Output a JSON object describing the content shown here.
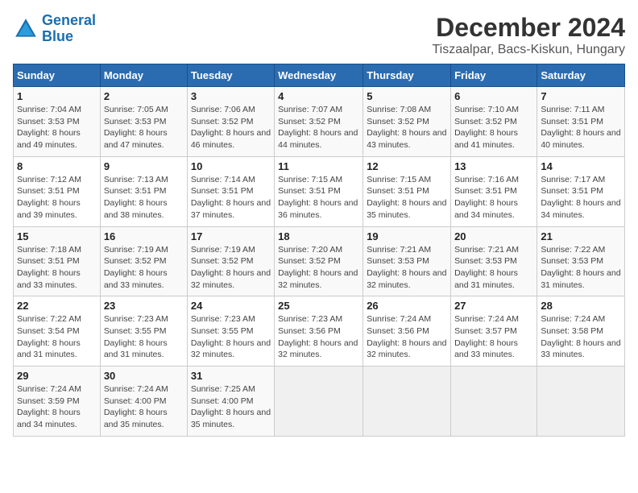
{
  "header": {
    "logo_line1": "General",
    "logo_line2": "Blue",
    "month_title": "December 2024",
    "location": "Tiszaalpar, Bacs-Kiskun, Hungary"
  },
  "calendar": {
    "weekdays": [
      "Sunday",
      "Monday",
      "Tuesday",
      "Wednesday",
      "Thursday",
      "Friday",
      "Saturday"
    ],
    "weeks": [
      [
        {
          "day": "1",
          "sunrise": "7:04 AM",
          "sunset": "3:53 PM",
          "daylight": "8 hours and 49 minutes."
        },
        {
          "day": "2",
          "sunrise": "7:05 AM",
          "sunset": "3:53 PM",
          "daylight": "8 hours and 47 minutes."
        },
        {
          "day": "3",
          "sunrise": "7:06 AM",
          "sunset": "3:52 PM",
          "daylight": "8 hours and 46 minutes."
        },
        {
          "day": "4",
          "sunrise": "7:07 AM",
          "sunset": "3:52 PM",
          "daylight": "8 hours and 44 minutes."
        },
        {
          "day": "5",
          "sunrise": "7:08 AM",
          "sunset": "3:52 PM",
          "daylight": "8 hours and 43 minutes."
        },
        {
          "day": "6",
          "sunrise": "7:10 AM",
          "sunset": "3:52 PM",
          "daylight": "8 hours and 41 minutes."
        },
        {
          "day": "7",
          "sunrise": "7:11 AM",
          "sunset": "3:51 PM",
          "daylight": "8 hours and 40 minutes."
        }
      ],
      [
        {
          "day": "8",
          "sunrise": "7:12 AM",
          "sunset": "3:51 PM",
          "daylight": "8 hours and 39 minutes."
        },
        {
          "day": "9",
          "sunrise": "7:13 AM",
          "sunset": "3:51 PM",
          "daylight": "8 hours and 38 minutes."
        },
        {
          "day": "10",
          "sunrise": "7:14 AM",
          "sunset": "3:51 PM",
          "daylight": "8 hours and 37 minutes."
        },
        {
          "day": "11",
          "sunrise": "7:15 AM",
          "sunset": "3:51 PM",
          "daylight": "8 hours and 36 minutes."
        },
        {
          "day": "12",
          "sunrise": "7:15 AM",
          "sunset": "3:51 PM",
          "daylight": "8 hours and 35 minutes."
        },
        {
          "day": "13",
          "sunrise": "7:16 AM",
          "sunset": "3:51 PM",
          "daylight": "8 hours and 34 minutes."
        },
        {
          "day": "14",
          "sunrise": "7:17 AM",
          "sunset": "3:51 PM",
          "daylight": "8 hours and 34 minutes."
        }
      ],
      [
        {
          "day": "15",
          "sunrise": "7:18 AM",
          "sunset": "3:51 PM",
          "daylight": "8 hours and 33 minutes."
        },
        {
          "day": "16",
          "sunrise": "7:19 AM",
          "sunset": "3:52 PM",
          "daylight": "8 hours and 33 minutes."
        },
        {
          "day": "17",
          "sunrise": "7:19 AM",
          "sunset": "3:52 PM",
          "daylight": "8 hours and 32 minutes."
        },
        {
          "day": "18",
          "sunrise": "7:20 AM",
          "sunset": "3:52 PM",
          "daylight": "8 hours and 32 minutes."
        },
        {
          "day": "19",
          "sunrise": "7:21 AM",
          "sunset": "3:53 PM",
          "daylight": "8 hours and 32 minutes."
        },
        {
          "day": "20",
          "sunrise": "7:21 AM",
          "sunset": "3:53 PM",
          "daylight": "8 hours and 31 minutes."
        },
        {
          "day": "21",
          "sunrise": "7:22 AM",
          "sunset": "3:53 PM",
          "daylight": "8 hours and 31 minutes."
        }
      ],
      [
        {
          "day": "22",
          "sunrise": "7:22 AM",
          "sunset": "3:54 PM",
          "daylight": "8 hours and 31 minutes."
        },
        {
          "day": "23",
          "sunrise": "7:23 AM",
          "sunset": "3:55 PM",
          "daylight": "8 hours and 31 minutes."
        },
        {
          "day": "24",
          "sunrise": "7:23 AM",
          "sunset": "3:55 PM",
          "daylight": "8 hours and 32 minutes."
        },
        {
          "day": "25",
          "sunrise": "7:23 AM",
          "sunset": "3:56 PM",
          "daylight": "8 hours and 32 minutes."
        },
        {
          "day": "26",
          "sunrise": "7:24 AM",
          "sunset": "3:56 PM",
          "daylight": "8 hours and 32 minutes."
        },
        {
          "day": "27",
          "sunrise": "7:24 AM",
          "sunset": "3:57 PM",
          "daylight": "8 hours and 33 minutes."
        },
        {
          "day": "28",
          "sunrise": "7:24 AM",
          "sunset": "3:58 PM",
          "daylight": "8 hours and 33 minutes."
        }
      ],
      [
        {
          "day": "29",
          "sunrise": "7:24 AM",
          "sunset": "3:59 PM",
          "daylight": "8 hours and 34 minutes."
        },
        {
          "day": "30",
          "sunrise": "7:24 AM",
          "sunset": "4:00 PM",
          "daylight": "8 hours and 35 minutes."
        },
        {
          "day": "31",
          "sunrise": "7:25 AM",
          "sunset": "4:00 PM",
          "daylight": "8 hours and 35 minutes."
        },
        null,
        null,
        null,
        null
      ]
    ]
  }
}
